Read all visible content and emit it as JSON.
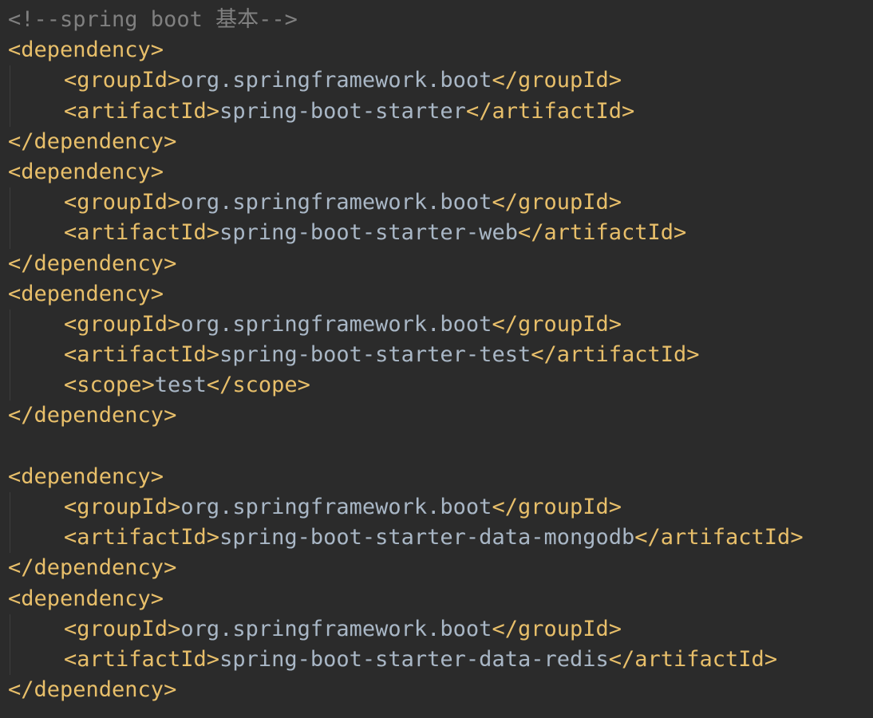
{
  "editor": {
    "background": "#2b2b2b",
    "colors": {
      "tag": "#e8bf6a",
      "text": "#a9b7c6",
      "comment": "#808080"
    },
    "comment": "<!--spring boot 基本-->",
    "lines": [
      {
        "type": "comment",
        "text": "<!--spring boot 基本-->"
      },
      {
        "type": "open",
        "tag": "<dependency>"
      },
      {
        "type": "elem",
        "open": "<groupId>",
        "value": "org.springframework.boot",
        "close": "</groupId>"
      },
      {
        "type": "elem",
        "open": "<artifactId>",
        "value": "spring-boot-starter",
        "close": "</artifactId>"
      },
      {
        "type": "close",
        "tag": "</dependency>"
      },
      {
        "type": "open",
        "tag": "<dependency>"
      },
      {
        "type": "elem",
        "open": "<groupId>",
        "value": "org.springframework.boot",
        "close": "</groupId>"
      },
      {
        "type": "elem",
        "open": "<artifactId>",
        "value": "spring-boot-starter-web",
        "close": "</artifactId>"
      },
      {
        "type": "close",
        "tag": "</dependency>"
      },
      {
        "type": "open",
        "tag": "<dependency>"
      },
      {
        "type": "elem",
        "open": "<groupId>",
        "value": "org.springframework.boot",
        "close": "</groupId>"
      },
      {
        "type": "elem",
        "open": "<artifactId>",
        "value": "spring-boot-starter-test",
        "close": "</artifactId>"
      },
      {
        "type": "elem",
        "open": "<scope>",
        "value": "test",
        "close": "</scope>"
      },
      {
        "type": "close",
        "tag": "</dependency>"
      },
      {
        "type": "blank"
      },
      {
        "type": "open",
        "tag": "<dependency>"
      },
      {
        "type": "elem",
        "open": "<groupId>",
        "value": "org.springframework.boot",
        "close": "</groupId>"
      },
      {
        "type": "elem",
        "open": "<artifactId>",
        "value": "spring-boot-starter-data-mongodb",
        "close": "</artifactId>"
      },
      {
        "type": "close",
        "tag": "</dependency>"
      },
      {
        "type": "open",
        "tag": "<dependency>"
      },
      {
        "type": "elem",
        "open": "<groupId>",
        "value": "org.springframework.boot",
        "close": "</groupId>"
      },
      {
        "type": "elem",
        "open": "<artifactId>",
        "value": "spring-boot-starter-data-redis",
        "close": "</artifactId>"
      },
      {
        "type": "close",
        "tag": "</dependency>"
      }
    ]
  }
}
